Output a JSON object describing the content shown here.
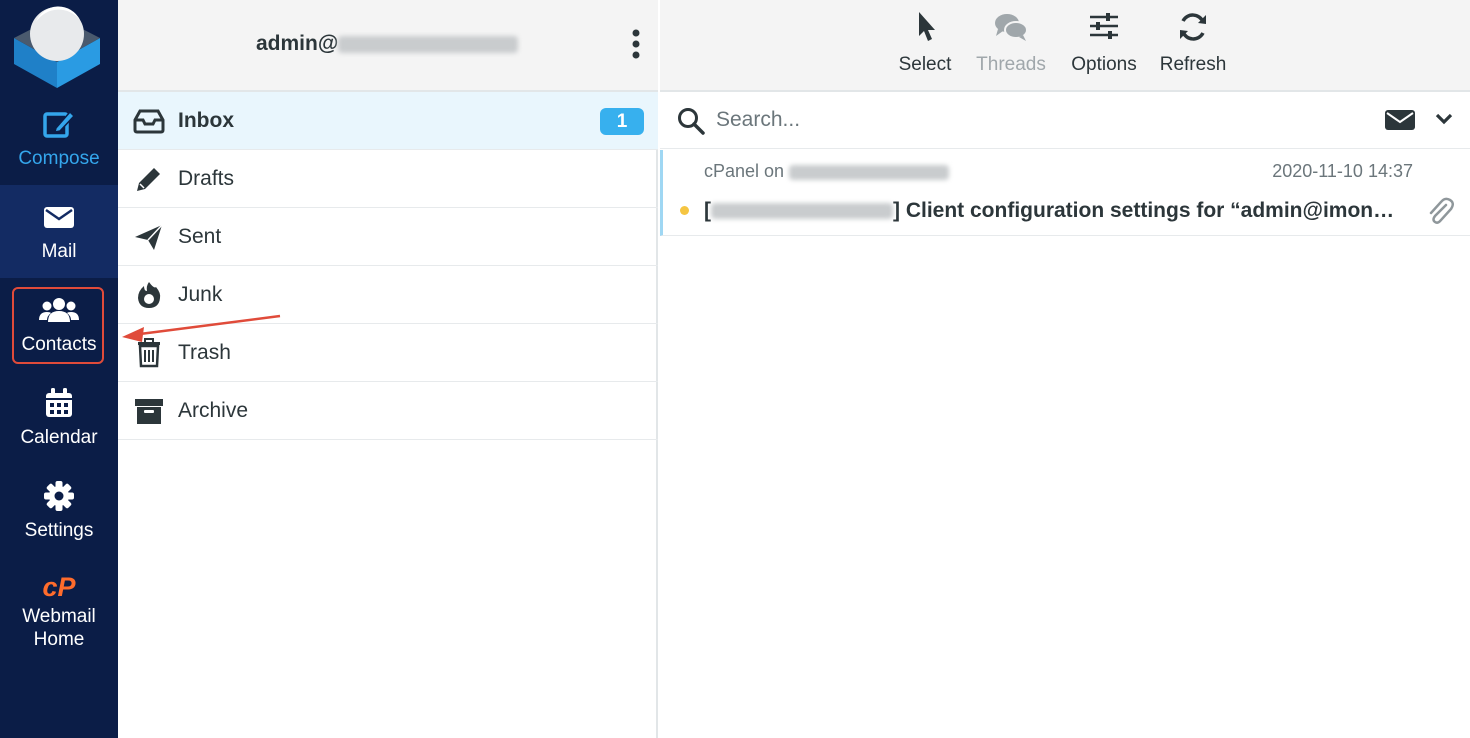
{
  "nav": {
    "items": [
      {
        "id": "compose",
        "label": "Compose",
        "icon": "compose-icon"
      },
      {
        "id": "mail",
        "label": "Mail",
        "icon": "envelope-icon"
      },
      {
        "id": "contacts",
        "label": "Contacts",
        "icon": "users-icon"
      },
      {
        "id": "calendar",
        "label": "Calendar",
        "icon": "calendar-icon"
      },
      {
        "id": "settings",
        "label": "Settings",
        "icon": "gear-icon"
      },
      {
        "id": "home",
        "label_line1": "Webmail",
        "label_line2": "Home",
        "icon": "cpanel-icon"
      }
    ],
    "active": "mail"
  },
  "account": {
    "prefix": "admin@"
  },
  "folders": [
    {
      "label": "Inbox",
      "icon": "inbox-icon",
      "unread": "1",
      "active": true
    },
    {
      "label": "Drafts",
      "icon": "pencil-icon"
    },
    {
      "label": "Sent",
      "icon": "paper-plane-icon"
    },
    {
      "label": "Junk",
      "icon": "fire-icon"
    },
    {
      "label": "Trash",
      "icon": "trash-icon"
    },
    {
      "label": "Archive",
      "icon": "archive-box-icon"
    }
  ],
  "toolbar": {
    "select": "Select",
    "threads": "Threads",
    "options": "Options",
    "refresh": "Refresh"
  },
  "search": {
    "placeholder": "Search..."
  },
  "messages": [
    {
      "from_prefix": "cPanel on",
      "date": "2020-11-10 14:37",
      "subject_open": "[",
      "subject_rest": "] Client configuration settings for “admin@imons…",
      "unread": true,
      "has_attachment": true
    }
  ],
  "colors": {
    "nav_bg": "#0b1d47",
    "nav_active": "#132b63",
    "accent": "#37b0ee",
    "compose": "#34a6ec",
    "cpanel": "#ff6c2c",
    "highlight": "#e04b3a"
  }
}
